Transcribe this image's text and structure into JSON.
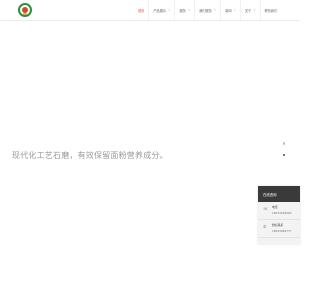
{
  "nav": {
    "items": [
      {
        "label": "首页",
        "caret": ""
      },
      {
        "label": "产品展示",
        "caret": "▽"
      },
      {
        "label": "服务",
        "caret": "▽"
      },
      {
        "label": "我们服务",
        "caret": "▽"
      },
      {
        "label": "新闻",
        "caret": "▽"
      },
      {
        "label": "关于",
        "caret": "▽"
      },
      {
        "label": "联系我们",
        "caret": ""
      }
    ],
    "accent_color": "#d54a2a"
  },
  "hero": {
    "text": "现代化工艺石磨，有效保留面粉营养成分。"
  },
  "carousel": {
    "total": 2,
    "active": 2
  },
  "contact": {
    "title": "在线咨询",
    "phone_label": "电话",
    "phone_value": "18033208365",
    "wechat_label": "微信联系",
    "wechat_value": "18093966777"
  }
}
